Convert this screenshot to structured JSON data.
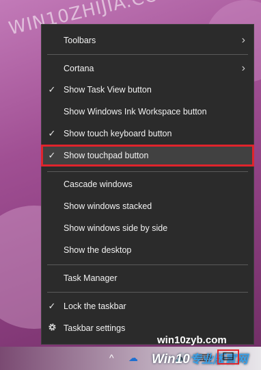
{
  "watermark": "WIN10ZHIJIA.COM",
  "menu": {
    "items": [
      {
        "label": "Toolbars",
        "checked": false,
        "submenu": true
      },
      {
        "label": "Cortana",
        "checked": false,
        "submenu": true
      },
      {
        "label": "Show Task View button",
        "checked": true
      },
      {
        "label": "Show Windows Ink Workspace button",
        "checked": false
      },
      {
        "label": "Show touch keyboard button",
        "checked": true
      },
      {
        "label": "Show touchpad button",
        "checked": true,
        "highlighted": true
      },
      {
        "label": "Cascade windows",
        "checked": false
      },
      {
        "label": "Show windows stacked",
        "checked": false
      },
      {
        "label": "Show windows side by side",
        "checked": false
      },
      {
        "label": "Show the desktop",
        "checked": false
      },
      {
        "label": "Task Manager",
        "checked": false
      },
      {
        "label": "Lock the taskbar",
        "checked": true
      },
      {
        "label": "Taskbar settings",
        "checked": false,
        "icon": "gear-icon"
      }
    ],
    "check_glyph": "✓",
    "arrow_glyph": "›"
  },
  "branding": {
    "site": "win10zyb.com",
    "logo_latin": "Win10",
    "logo_cn": "专业版官网"
  },
  "colors": {
    "menu_bg": "#2b2b2b",
    "highlight_border": "#e0242c"
  }
}
